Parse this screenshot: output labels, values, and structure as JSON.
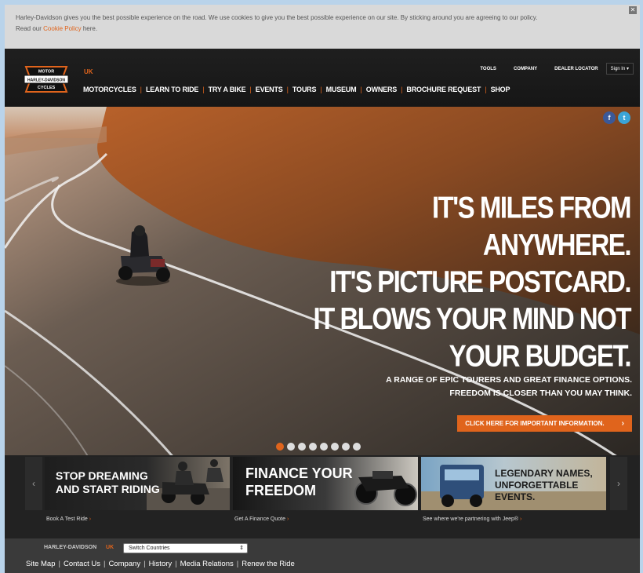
{
  "cookie_banner": {
    "text": "Harley-Davidson gives you the best possible experience on the road. We use cookies to give you the best possible experience on our site. By sticking around you are agreeing to our policy.",
    "text2_prefix": "Read our ",
    "link": "Cookie Policy",
    "text2_suffix": " here.",
    "close": "✕"
  },
  "header": {
    "logo_text": [
      "MOTOR",
      "HARLEY-DAVIDSON",
      "CYCLES"
    ],
    "region": "UK",
    "nav": [
      "MOTORCYCLES",
      "LEARN TO RIDE",
      "TRY A BIKE",
      "EVENTS",
      "TOURS",
      "MUSEUM",
      "OWNERS",
      "BROCHURE REQUEST",
      "SHOP"
    ],
    "utility": [
      "TOOLS",
      "COMPANY",
      "DEALER LOCATOR"
    ],
    "sign_in": "Sign In",
    "sign_in_caret": "▾"
  },
  "hero": {
    "headline": "IT'S MILES FROM\nANYWHERE.\nIT'S PICTURE POSTCARD.\nIT BLOWS YOUR MIND NOT\nYOUR BUDGET.",
    "subline": "A RANGE OF EPIC TOURERS AND GREAT FINANCE OPTIONS.\nFREEDOM IS CLOSER THAN YOU MAY THINK.",
    "cta": "CLICK HERE FOR IMPORTANT INFORMATION.",
    "cta_arrow": "›",
    "social": {
      "facebook": "f",
      "twitter": "t"
    },
    "slide_count": 8,
    "active_slide": 1
  },
  "promos": [
    {
      "title": "STOP DREAMING\nAND START RIDING",
      "link": "Book A Test Ride"
    },
    {
      "title": "FINANCE YOUR\nFREEDOM",
      "link": "Get A Finance Quote"
    },
    {
      "title": "LEGENDARY NAMES,\nUNFORGETTABLE EVENTS.",
      "link": "See where we're partnering with Jeep®"
    }
  ],
  "promo_chevron": "›",
  "carousel_prev": "‹",
  "carousel_next": "›",
  "footer": {
    "brand": "HARLEY-DAVIDSON",
    "region": "UK",
    "select_value": "Switch Countries",
    "select_caret": "⇕",
    "links": [
      "Site Map",
      "Contact Us",
      "Company",
      "History",
      "Media Relations",
      "Renew the Ride"
    ]
  },
  "colors": {
    "accent": "#e0641c",
    "header_bg": "#1b1b1b",
    "footer_bg": "#3a3a3a",
    "cookie_bg": "#d9d9d9",
    "facebook": "#3b5998",
    "twitter": "#3aa4d8"
  },
  "icons": [
    "close-icon",
    "facebook-icon",
    "twitter-icon",
    "chevron-right-icon",
    "chevron-left-icon"
  ]
}
